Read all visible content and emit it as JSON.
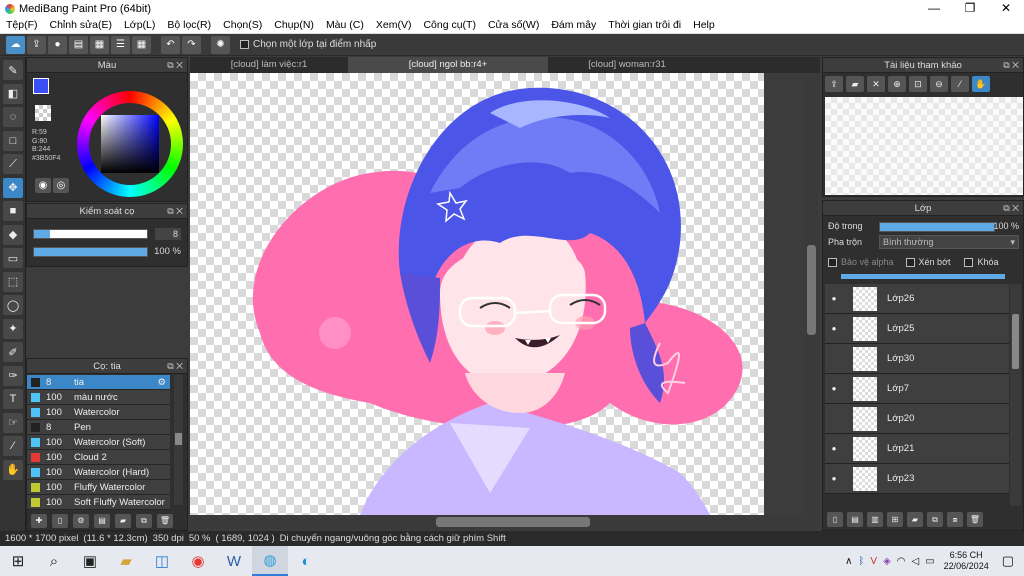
{
  "window": {
    "title": "MediBang Paint Pro (64bit)",
    "minimize": "—",
    "maximize": "❐",
    "close": "✕"
  },
  "menu": [
    "Tệp(F)",
    "Chỉnh sửa(E)",
    "Lớp(L)",
    "Bộ lọc(R)",
    "Chọn(S)",
    "Chụp(N)",
    "Màu (C)",
    "Xem(V)",
    "Công cụ(T)",
    "Cửa số(W)",
    "Đám mây",
    "Thời gian trôi đi",
    "Help"
  ],
  "toolbar": {
    "snap_label": "Chọn một lớp tại điểm nhấp"
  },
  "color_panel": {
    "title": "Màu",
    "r": "R:59",
    "g": "G:80",
    "b": "B:244",
    "hex": "#3B50F4",
    "fg_color": "#3B50F4"
  },
  "brush_control": {
    "title": "Kiểm soát cọ",
    "size_value": "8",
    "opacity_value": "100 %"
  },
  "brush_panel": {
    "title": "Cọ: tia",
    "items": [
      {
        "num": "8",
        "name": "tia",
        "color": "#222222"
      },
      {
        "num": "100",
        "name": "màu nước",
        "color": "#4fc3f7"
      },
      {
        "num": "100",
        "name": "Watercolor",
        "color": "#4fc3f7"
      },
      {
        "num": "8",
        "name": "Pen",
        "color": "#222222"
      },
      {
        "num": "100",
        "name": "Watercolor (Soft)",
        "color": "#4fc3f7"
      },
      {
        "num": "100",
        "name": "Cloud 2",
        "color": "#e53935"
      },
      {
        "num": "100",
        "name": "Watercolor (Hard)",
        "color": "#4fc3f7"
      },
      {
        "num": "100",
        "name": "Fluffy Watercolor",
        "color": "#c0ca33"
      },
      {
        "num": "100",
        "name": "Soft Fluffy Watercolor",
        "color": "#c0ca33"
      }
    ]
  },
  "tabs": [
    "[cloud] làm việc:r1",
    "[cloud] ngol bb:r4+",
    "[cloud] woman:r31"
  ],
  "reference_panel": {
    "title": "Tài liệu tham khảo"
  },
  "layer_panel": {
    "title": "Lớp",
    "opacity_label": "Độ trong",
    "opacity_value": "100 %",
    "blend_label": "Pha trộn",
    "blend_value": "Bình thường",
    "protect_alpha": "Bảo vệ alpha",
    "clipping": "Xén bớt",
    "lock": "Khóa",
    "layers": [
      "Lớp26",
      "Lớp25",
      "Lớp30",
      "Lớp7",
      "Lớp20",
      "Lớp21",
      "Lớp23"
    ]
  },
  "status": {
    "size": "1600 * 1700 pixel",
    "cm": "(11.6 * 12.3cm)",
    "dpi": "350 dpi",
    "zoom": "50 %",
    "coords": "( 1689, 1024 )",
    "hint": "Di chuyển ngang/vuông góc bằng cách giữ phím Shift"
  },
  "taskbar": {
    "time": "6:56 CH",
    "date": "22/06/2024"
  }
}
